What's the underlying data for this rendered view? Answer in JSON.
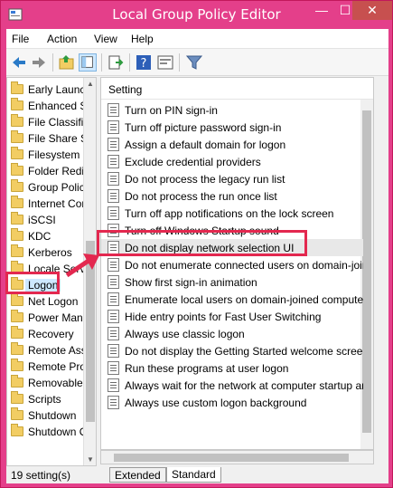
{
  "window": {
    "title": "Local Group Policy Editor",
    "minimize": "—",
    "maximize": "☐",
    "close": "✕"
  },
  "menu": [
    "File",
    "Action",
    "View",
    "Help"
  ],
  "toolbar": {
    "icons": [
      "back-icon",
      "forward-icon",
      "up-folder-icon",
      "show-hide-tree-icon",
      "export-list-icon",
      "help-icon",
      "properties-icon",
      "filter-icon"
    ]
  },
  "tree": {
    "items": [
      {
        "label": "Early Launch Antimalware"
      },
      {
        "label": "Enhanced Storage Access"
      },
      {
        "label": "File Classification Infrastructure"
      },
      {
        "label": "File Share Shadow Copy Provider"
      },
      {
        "label": "Filesystem"
      },
      {
        "label": "Folder Redirection"
      },
      {
        "label": "Group Policy"
      },
      {
        "label": "Internet Communication Management"
      },
      {
        "label": "iSCSI"
      },
      {
        "label": "KDC"
      },
      {
        "label": "Kerberos"
      },
      {
        "label": "Locale Services"
      },
      {
        "label": "Logon",
        "selected": true
      },
      {
        "label": "Net Logon"
      },
      {
        "label": "Power Management"
      },
      {
        "label": "Recovery"
      },
      {
        "label": "Remote Assistance"
      },
      {
        "label": "Remote Procedure Call"
      },
      {
        "label": "Removable Storage Access"
      },
      {
        "label": "Scripts"
      },
      {
        "label": "Shutdown"
      },
      {
        "label": "Shutdown Options"
      }
    ]
  },
  "settings": {
    "header": "Setting",
    "rows": [
      "Turn on PIN sign-in",
      "Turn off picture password sign-in",
      "Assign a default domain for logon",
      "Exclude credential providers",
      "Do not process the legacy run list",
      "Do not process the run once list",
      "Turn off app notifications on the lock screen",
      "Turn off Windows Startup sound",
      "Do not display network selection UI",
      "Do not enumerate connected users on domain-joined computers",
      "Show first sign-in animation",
      "Enumerate local users on domain-joined computers",
      "Hide entry points for Fast User Switching",
      "Always use classic logon",
      "Do not display the Getting Started welcome screen at logon",
      "Run these programs at user logon",
      "Always wait for the network at computer startup and logon",
      "Always use custom logon background"
    ],
    "highlighted_index": 8
  },
  "tabs": [
    {
      "label": "Extended"
    },
    {
      "label": "Standard",
      "active": true
    }
  ],
  "status": {
    "text": "19 setting(s)"
  },
  "colors": {
    "titlebar": "#e43f8a",
    "annotation": "#e3284f",
    "selection": "#cde8ff"
  }
}
